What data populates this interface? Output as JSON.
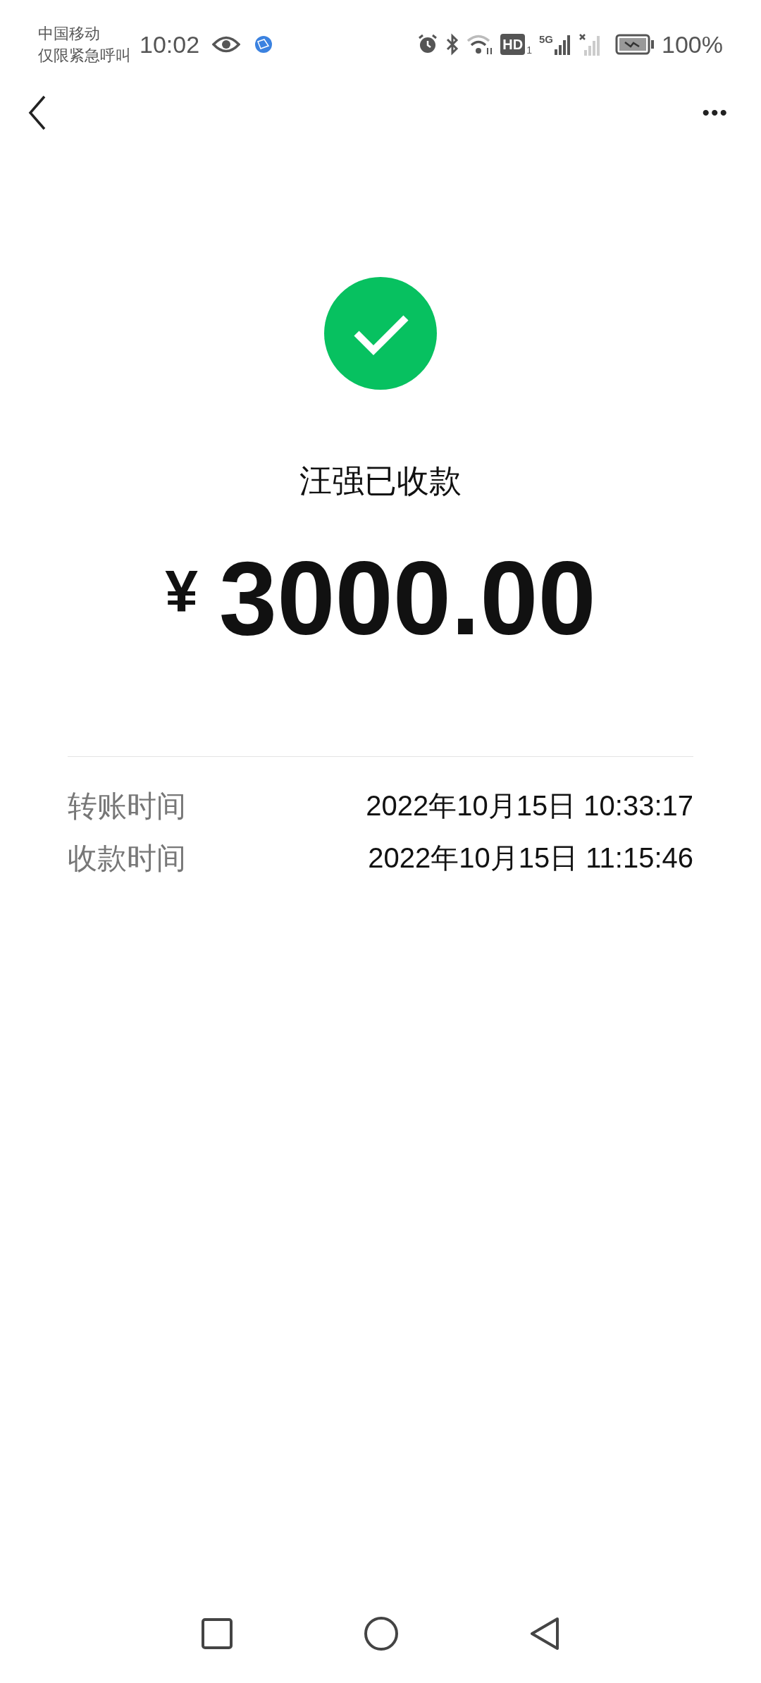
{
  "status_bar": {
    "carrier": "中国移动",
    "carrier_note": "仅限紧急呼叫",
    "time": "10:02",
    "hd_label": "HD",
    "hd_sim": "1",
    "network": "5G",
    "battery": "100%"
  },
  "header": {
    "more": "•••"
  },
  "result": {
    "payee_status": "汪强已收款",
    "currency": "¥",
    "amount": "3000.00"
  },
  "details": [
    {
      "label": "转账时间",
      "value": "2022年10月15日 10:33:17"
    },
    {
      "label": "收款时间",
      "value": "2022年10月15日 11:15:46"
    }
  ]
}
